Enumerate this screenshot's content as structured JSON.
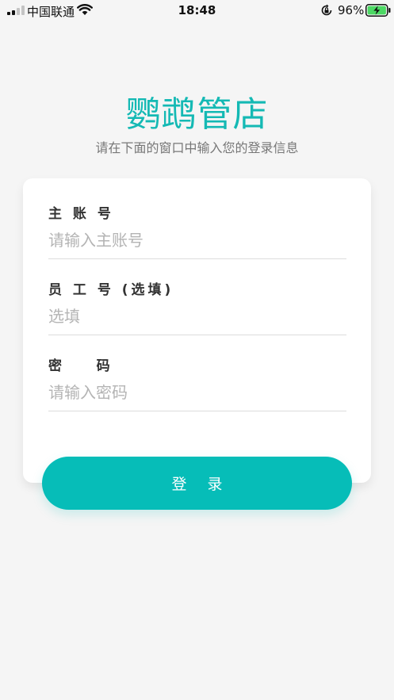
{
  "status_bar": {
    "carrier": "中国联通",
    "time": "18:48",
    "battery_percent": "96%",
    "icons": [
      "signal-icon",
      "wifi-icon",
      "rotation-lock-icon",
      "battery-charging-icon"
    ]
  },
  "header": {
    "title": "鹦鹉管店",
    "subtitle": "请在下面的窗口中输入您的登录信息",
    "title_color": "#14b9b4"
  },
  "form": {
    "account": {
      "label": "主 账 号",
      "value": "",
      "placeholder": "请输入主账号"
    },
    "employee": {
      "label": "员 工 号 (选填)",
      "value": "",
      "placeholder": "选填"
    },
    "password": {
      "label": "密    码",
      "value": "",
      "placeholder": "请输入密码"
    }
  },
  "login_button": {
    "label": "登 录",
    "color": "#06bdb8"
  }
}
